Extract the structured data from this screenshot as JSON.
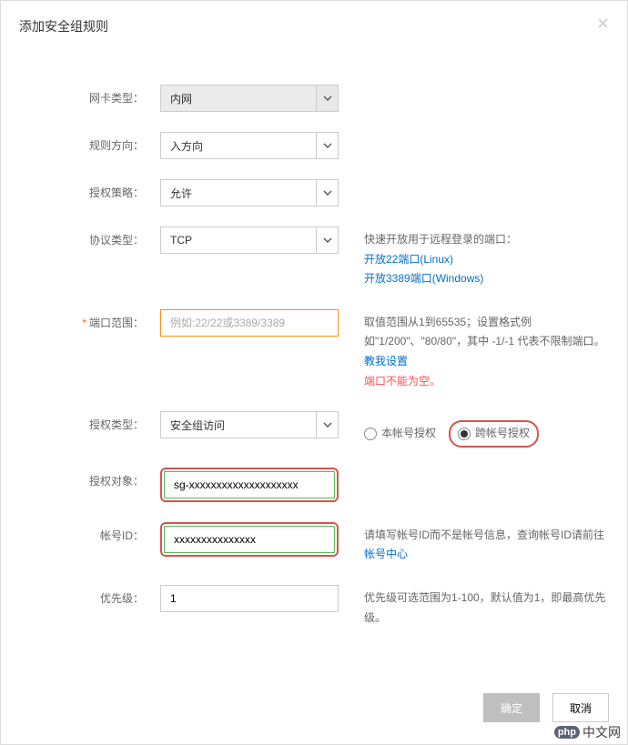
{
  "title": "添加安全组规则",
  "fields": {
    "nic_type": {
      "label": "网卡类型：",
      "value": "内网"
    },
    "direction": {
      "label": "规则方向：",
      "value": "入方向"
    },
    "policy": {
      "label": "授权策略：",
      "value": "允许"
    },
    "protocol": {
      "label": "协议类型：",
      "value": "TCP"
    },
    "port": {
      "label": "端口范围：",
      "placeholder": "例如:22/22或3389/3389",
      "value": ""
    },
    "auth_type": {
      "label": "授权类型：",
      "value": "安全组访问"
    },
    "auth_object": {
      "label": "授权对象：",
      "value": "sg-xxxxxxxxxxxxxxxxxxxx"
    },
    "account_id": {
      "label": "帐号ID：",
      "value": "xxxxxxxxxxxxxxx"
    },
    "priority": {
      "label": "优先级：",
      "value": "1"
    }
  },
  "protocol_help": {
    "intro": "快速开放用于远程登录的端口：",
    "link1": "开放22端口(Linux)",
    "link2": "开放3389端口(Windows)"
  },
  "port_help": {
    "text1": "取值范围从1到65535；设置格式例如\"1/200\"、\"80/80\"，其中 -1/-1 代表不限制端口。  ",
    "link": "教我设置",
    "error": "端口不能为空。"
  },
  "auth_radio": {
    "opt1": "本帐号授权",
    "opt2": "跨帐号授权"
  },
  "account_help": {
    "text": "请填写帐号ID而不是帐号信息，查询帐号ID请前往 ",
    "link": "帐号中心"
  },
  "priority_help": "优先级可选范围为1-100，默认值为1，即最高优先级。",
  "buttons": {
    "ok": "确定",
    "cancel": "取消"
  },
  "watermark": {
    "php": "php",
    "cn": "中文网"
  }
}
